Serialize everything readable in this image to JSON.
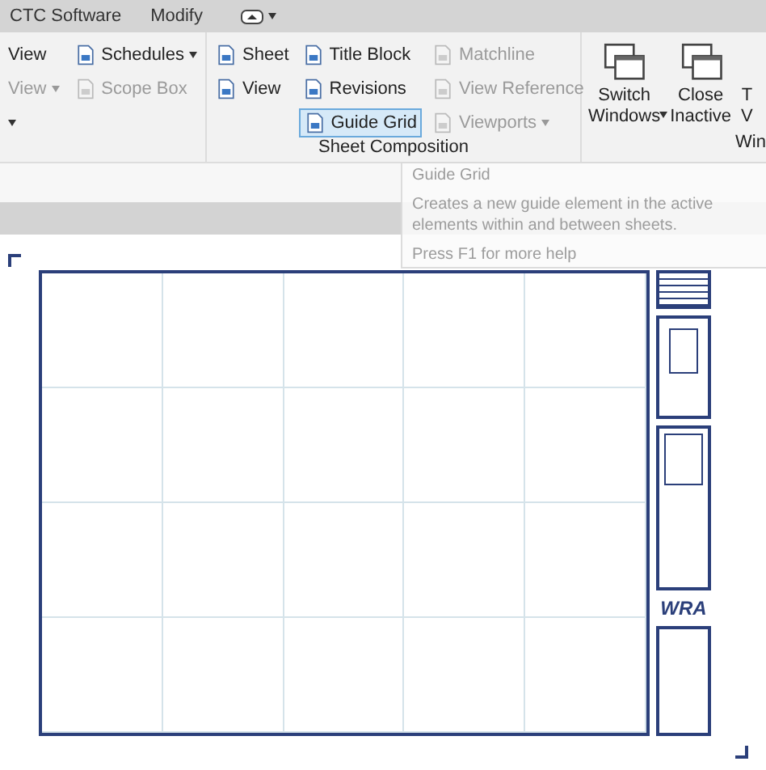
{
  "tabs": [
    {
      "label": "CTC Software",
      "selected": false
    },
    {
      "label": "Modify",
      "selected": false
    }
  ],
  "quick_access": {
    "dropdown": true
  },
  "panels": [
    {
      "columns": [
        [
          {
            "label": "View",
            "disabled": false,
            "selected": false,
            "dropdown": false,
            "icon": false
          },
          {
            "label": "View",
            "disabled": true,
            "selected": false,
            "dropdown": true,
            "icon": false
          },
          {
            "disabled": false,
            "selected": false,
            "dropdown": true,
            "icon": false
          }
        ],
        [
          {
            "label": "Schedules",
            "disabled": false,
            "selected": false,
            "dropdown": true,
            "icon": true
          },
          {
            "label": "Scope Box",
            "disabled": true,
            "selected": false,
            "dropdown": false,
            "icon": true
          }
        ]
      ]
    },
    {
      "label": "Sheet Composition",
      "columns": [
        [
          {
            "label": "Sheet",
            "disabled": false,
            "selected": false,
            "dropdown": false,
            "icon": true
          },
          {
            "label": "View",
            "disabled": false,
            "selected": false,
            "dropdown": false,
            "icon": true
          }
        ],
        [
          {
            "label": "Title Block",
            "disabled": false,
            "selected": false,
            "dropdown": false,
            "icon": true
          },
          {
            "label": "Revisions",
            "disabled": false,
            "selected": false,
            "dropdown": false,
            "icon": true
          },
          {
            "label": "Guide Grid",
            "disabled": false,
            "selected": true,
            "dropdown": false,
            "icon": true
          }
        ],
        [
          {
            "label": "Matchline",
            "disabled": true,
            "selected": false,
            "dropdown": false,
            "icon": true
          },
          {
            "label": "View Reference",
            "disabled": true,
            "selected": false,
            "dropdown": false,
            "icon": true
          },
          {
            "label": "Viewports",
            "disabled": true,
            "selected": false,
            "dropdown": true,
            "icon": true
          }
        ]
      ]
    },
    {
      "label": "Win",
      "large": [
        {
          "lines": [
            "Switch",
            "Windows"
          ],
          "dropdown": true,
          "icon": true
        },
        {
          "lines": [
            "Close",
            "Inactive"
          ],
          "dropdown": false,
          "icon": true
        },
        {
          "lines": [
            "T",
            "V"
          ],
          "icon": false
        }
      ]
    }
  ],
  "tooltip": {
    "title": "Guide Grid",
    "lines": [
      "Creates a new guide element in the active",
      "elements within and between sheets."
    ],
    "help": "Press F1 for more help"
  },
  "sheet": {
    "logo": "WRA"
  }
}
